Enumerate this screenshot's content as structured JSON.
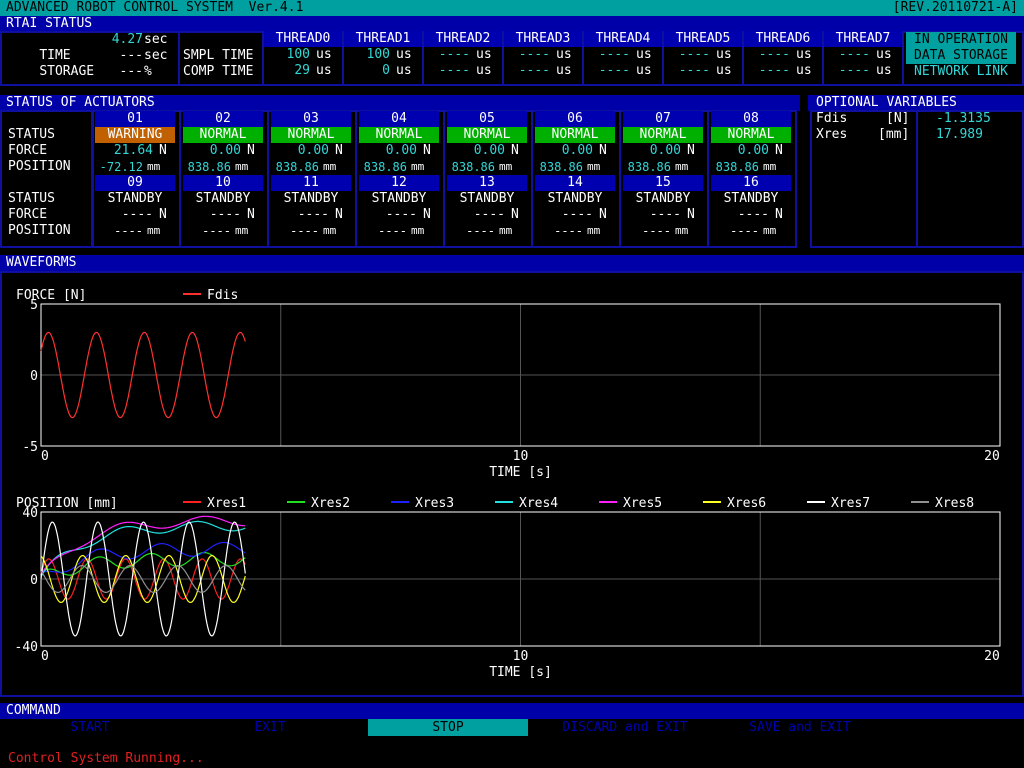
{
  "title_bar": {
    "title": "ADVANCED ROBOT CONTROL SYSTEM  Ver.4.1",
    "revision": "[REV.20110721-A]"
  },
  "rtai": {
    "section_title": "RTAI STATUS",
    "time_label": "TIME",
    "time_value": "4.27",
    "time_unit": "sec",
    "storage_label": "STORAGE",
    "storage_value": "---",
    "storage_unit": "sec",
    "storage_pct_value": "---",
    "storage_pct_unit": "%",
    "smpl_label": "SMPL TIME",
    "comp_label": "COMP TIME",
    "threads": [
      {
        "name": "THREAD0",
        "smpl": "100",
        "comp": "29"
      },
      {
        "name": "THREAD1",
        "smpl": "100",
        "comp": "0"
      },
      {
        "name": "THREAD2",
        "smpl": "----",
        "comp": "----"
      },
      {
        "name": "THREAD3",
        "smpl": "----",
        "comp": "----"
      },
      {
        "name": "THREAD4",
        "smpl": "----",
        "comp": "----"
      },
      {
        "name": "THREAD5",
        "smpl": "----",
        "comp": "----"
      },
      {
        "name": "THREAD6",
        "smpl": "----",
        "comp": "----"
      },
      {
        "name": "THREAD7",
        "smpl": "----",
        "comp": "----"
      }
    ],
    "thread_unit": "us",
    "indicators": [
      "IN OPERATION",
      "DATA STORAGE",
      "NETWORK LINK"
    ]
  },
  "actuators": {
    "section_title": "STATUS OF ACTUATORS",
    "row_labels": [
      "STATUS",
      "FORCE",
      "POSITION"
    ],
    "force_unit": "N",
    "position_unit": "mm",
    "group1": [
      {
        "id": "01",
        "status": "WARNING",
        "force": "21.64",
        "position": "-72.12"
      },
      {
        "id": "02",
        "status": "NORMAL",
        "force": "0.00",
        "position": "838.86"
      },
      {
        "id": "03",
        "status": "NORMAL",
        "force": "0.00",
        "position": "838.86"
      },
      {
        "id": "04",
        "status": "NORMAL",
        "force": "0.00",
        "position": "838.86"
      },
      {
        "id": "05",
        "status": "NORMAL",
        "force": "0.00",
        "position": "838.86"
      },
      {
        "id": "06",
        "status": "NORMAL",
        "force": "0.00",
        "position": "838.86"
      },
      {
        "id": "07",
        "status": "NORMAL",
        "force": "0.00",
        "position": "838.86"
      },
      {
        "id": "08",
        "status": "NORMAL",
        "force": "0.00",
        "position": "838.86"
      }
    ],
    "group2": [
      {
        "id": "09",
        "status": "STANDBY",
        "force": "----",
        "position": "----"
      },
      {
        "id": "10",
        "status": "STANDBY",
        "force": "----",
        "position": "----"
      },
      {
        "id": "11",
        "status": "STANDBY",
        "force": "----",
        "position": "----"
      },
      {
        "id": "12",
        "status": "STANDBY",
        "force": "----",
        "position": "----"
      },
      {
        "id": "13",
        "status": "STANDBY",
        "force": "----",
        "position": "----"
      },
      {
        "id": "14",
        "status": "STANDBY",
        "force": "----",
        "position": "----"
      },
      {
        "id": "15",
        "status": "STANDBY",
        "force": "----",
        "position": "----"
      },
      {
        "id": "16",
        "status": "STANDBY",
        "force": "----",
        "position": "----"
      }
    ]
  },
  "optional": {
    "section_title": "OPTIONAL VARIABLES",
    "vars": [
      {
        "name": "Fdis",
        "unit": "[N]",
        "value": "-1.3135"
      },
      {
        "name": "Xres",
        "unit": "[mm]",
        "value": "17.989"
      }
    ]
  },
  "waveforms": {
    "section_title": "WAVEFORMS"
  },
  "chart_data": [
    {
      "type": "line",
      "ylabel": "FORCE [N]",
      "xlabel": "TIME [s]",
      "xlim": [
        0,
        20
      ],
      "ylim": [
        -5,
        5
      ],
      "xticks": [
        "0",
        "10",
        "20"
      ],
      "yticks": [
        "5",
        "0",
        "-5"
      ],
      "series": [
        {
          "name": "Fdis",
          "color": "#ff3030",
          "amplitude": 3.0,
          "offset": 0,
          "period_s": 1.0,
          "phase": 0.6,
          "t_end": 4.27
        }
      ]
    },
    {
      "type": "line",
      "ylabel": "POSITION [mm]",
      "xlabel": "TIME [s]",
      "xlim": [
        0,
        20
      ],
      "ylim": [
        -40,
        40
      ],
      "xticks": [
        "0",
        "10",
        "20"
      ],
      "yticks": [
        "40",
        "0",
        "-40"
      ],
      "series": [
        {
          "name": "Xres1",
          "color": "#ff2020",
          "amplitude": 12,
          "offset": 0,
          "period_s": 0.8,
          "phase": 0.3,
          "t_end": 4.27
        },
        {
          "name": "Xres2",
          "color": "#20e020",
          "amplitude": 4,
          "offset": 12,
          "period_s": 1.1,
          "phase": 1.0,
          "t_end": 4.27
        },
        {
          "name": "Xres3",
          "color": "#2020ff",
          "amplitude": 4,
          "offset": 18,
          "period_s": 1.3,
          "phase": 2.0,
          "t_end": 4.27
        },
        {
          "name": "Xres4",
          "color": "#20e0e0",
          "amplitude": 3,
          "offset": 32,
          "period_s": 1.5,
          "phase": 0.5,
          "t_end": 4.27
        },
        {
          "name": "Xres5",
          "color": "#ff20ff",
          "amplitude": 3,
          "offset": 35,
          "period_s": 1.7,
          "phase": 1.5,
          "t_end": 4.27
        },
        {
          "name": "Xres6",
          "color": "#ffff20",
          "amplitude": 14,
          "offset": 0,
          "period_s": 0.9,
          "phase": 1.8,
          "t_end": 4.27
        },
        {
          "name": "Xres7",
          "color": "#ffffff",
          "amplitude": 34,
          "offset": 0,
          "period_s": 0.95,
          "phase": 0.0,
          "t_end": 4.27
        },
        {
          "name": "Xres8",
          "color": "#909090",
          "amplitude": 8,
          "offset": 0,
          "period_s": 1.0,
          "phase": 2.5,
          "t_end": 4.27
        }
      ]
    }
  ],
  "command": {
    "section_title": "COMMAND",
    "buttons": [
      "START",
      "EXIT",
      "STOP",
      "DISCARD and EXIT",
      "SAVE and EXIT"
    ]
  },
  "status_line": "Control System Running..."
}
